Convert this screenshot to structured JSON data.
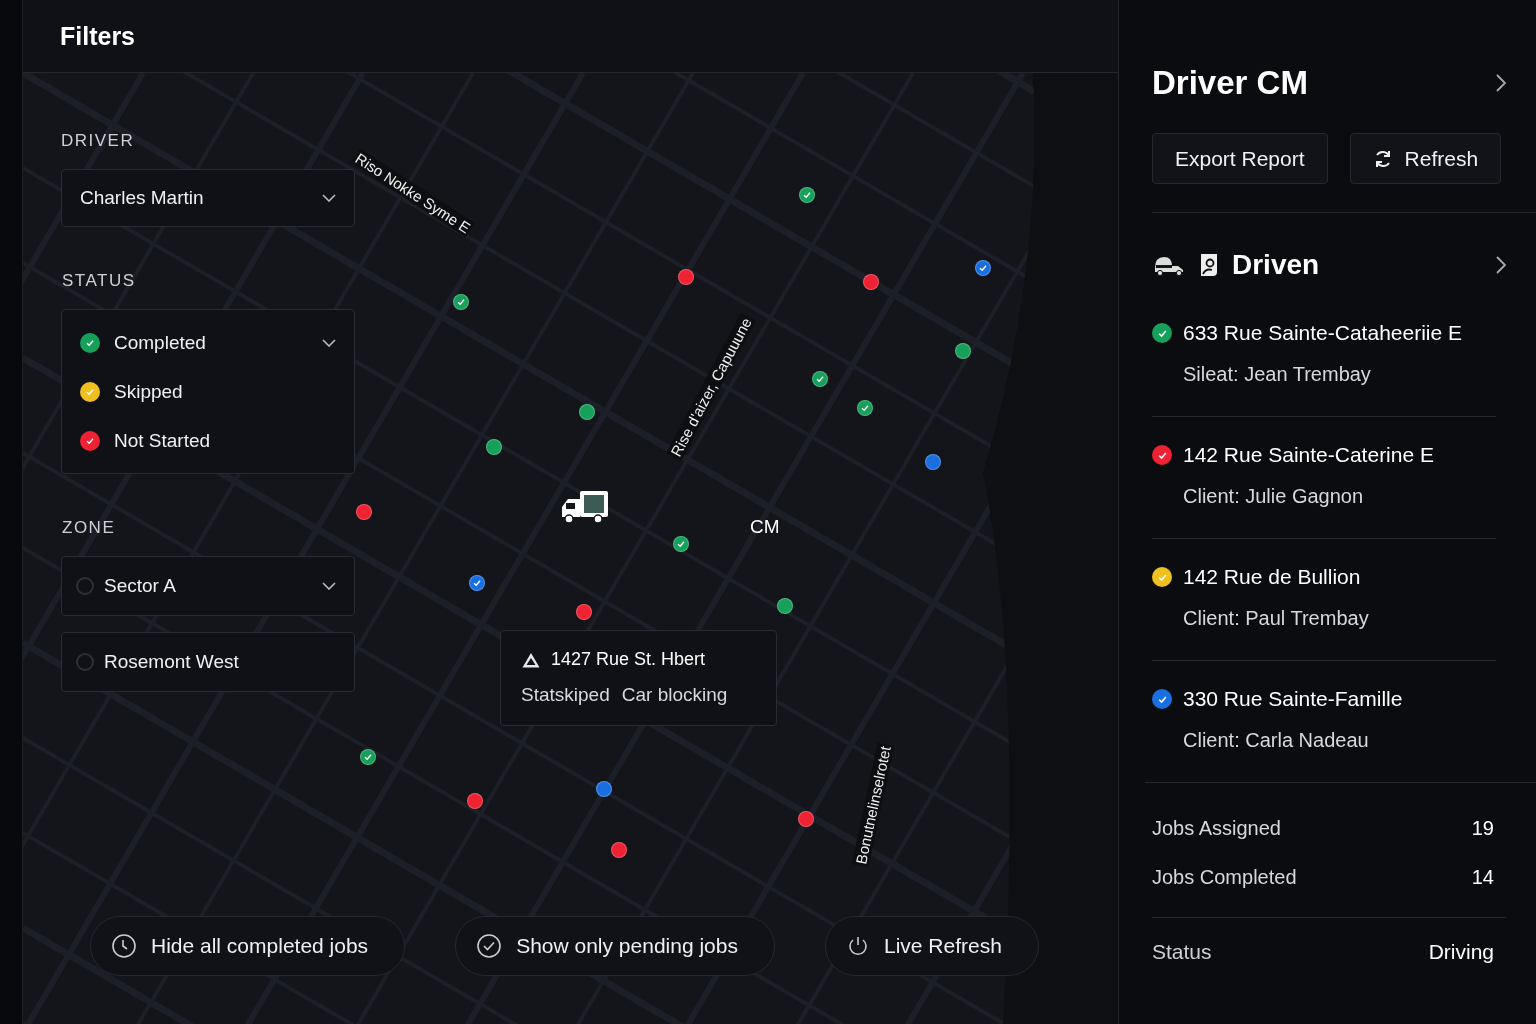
{
  "header": {
    "title": "Filters"
  },
  "filters": {
    "driver": {
      "label": "DRIVER",
      "value": "Charles Martin"
    },
    "status": {
      "label": "STATUS",
      "items": [
        {
          "label": "Completed",
          "color": "#16a05a"
        },
        {
          "label": "Skipped",
          "color": "#f0c020"
        },
        {
          "label": "Not Started",
          "color": "#ee2233"
        }
      ]
    },
    "zone": {
      "label": "ZONE",
      "items": [
        {
          "label": "Sector A",
          "selected": false,
          "dropdown": true
        },
        {
          "label": "Rosemont West",
          "selected": false,
          "dropdown": false
        }
      ]
    }
  },
  "map": {
    "streets": [
      "Riso Nokke Syme E",
      "Rise d'aizer, Capuuune",
      "Bonutnelinselrotet"
    ],
    "driver_label": "CM",
    "pins": [
      {
        "color": "#16a05a",
        "checked": true
      },
      {
        "color": "#ee2233",
        "checked": false
      },
      {
        "color": "#ee2233",
        "checked": false
      },
      {
        "color": "#1a6fe0",
        "checked": true
      },
      {
        "color": "#16a05a",
        "checked": true
      },
      {
        "color": "#16a05a",
        "checked": false
      },
      {
        "color": "#16a05a",
        "checked": true
      },
      {
        "color": "#16a05a",
        "checked": true
      },
      {
        "color": "#16a05a",
        "checked": false
      },
      {
        "color": "#16a05a",
        "checked": false
      },
      {
        "color": "#1a6fe0",
        "checked": false
      },
      {
        "color": "#ee2233",
        "checked": false
      },
      {
        "color": "#16a05a",
        "checked": true
      },
      {
        "color": "#1a6fe0",
        "checked": true
      },
      {
        "color": "#ee2233",
        "checked": false
      },
      {
        "color": "#16a05a",
        "checked": false
      },
      {
        "color": "#16a05a",
        "checked": true
      },
      {
        "color": "#ee2233",
        "checked": false
      },
      {
        "color": "#1a6fe0",
        "checked": false
      },
      {
        "color": "#ee2233",
        "checked": false
      },
      {
        "color": "#ee2233",
        "checked": false
      }
    ],
    "popup": {
      "address": "1427 Rue St. Hbert",
      "status": "Statskiped",
      "note": "Car blocking"
    }
  },
  "actions": [
    "Hide all completed jobs",
    "Show only pending jobs",
    "Live Refresh"
  ],
  "panel": {
    "title": "Driver CM",
    "buttons": [
      "Export Report",
      "Refresh"
    ],
    "section": "Driven",
    "jobs": [
      {
        "address": "633 Rue Sainte-Cataheeriie E",
        "client": "Sileat: Jean Trembay",
        "color": "#16a05a"
      },
      {
        "address": "142 Rue Sainte-Caterine E",
        "client": "Client: Julie Gagnon",
        "color": "#ee2233"
      },
      {
        "address": "142 Rue de Bullion",
        "client": "Client: Paul Trembay",
        "color": "#f0c020"
      },
      {
        "address": "330 Rue Sainte-Famille",
        "client": "Client: Carla Nadeau",
        "color": "#1a6fe0"
      }
    ],
    "stats": [
      {
        "label": "Jobs Assigned",
        "value": "19"
      },
      {
        "label": "Jobs Completed",
        "value": "14"
      }
    ],
    "status": {
      "label": "Status",
      "value": "Driving"
    }
  }
}
